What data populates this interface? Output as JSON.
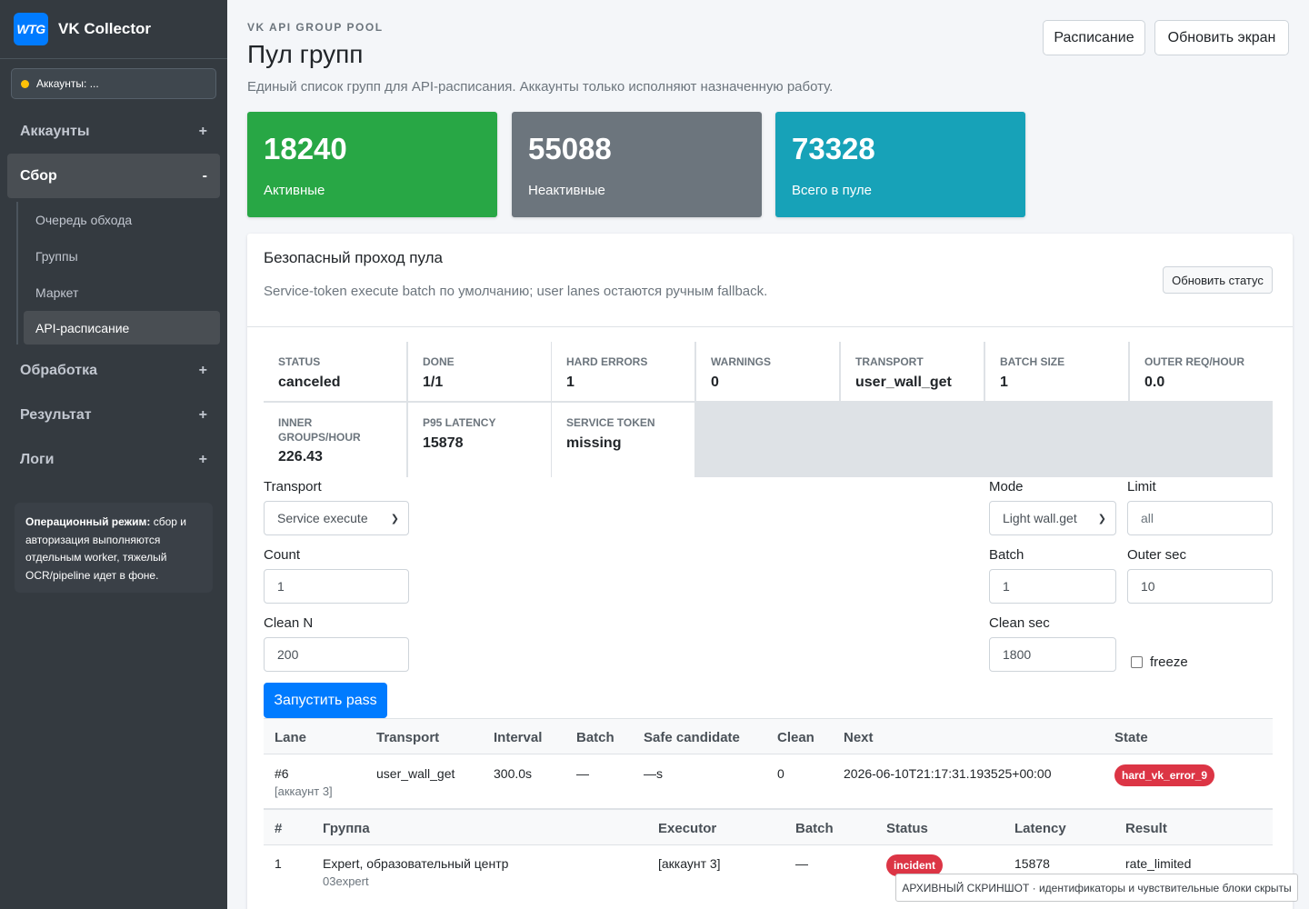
{
  "brand": {
    "logo": "WTG",
    "title": "VK Collector"
  },
  "sidebar": {
    "account": "Аккаунты: ...",
    "items": [
      {
        "label": "Аккаунты",
        "sign": "+"
      },
      {
        "label": "Сбор",
        "sign": "-"
      },
      {
        "label": "Обработка",
        "sign": "+"
      },
      {
        "label": "Результат",
        "sign": "+"
      },
      {
        "label": "Логи",
        "sign": "+"
      }
    ],
    "sub_items": [
      "Очередь обхода",
      "Группы",
      "Маркет",
      "API-расписание"
    ],
    "note_bold": "Операционный режим:",
    "note_text": " сбор и авторизация выполняются отдельным worker, тяжелый OCR/pipeline идет в фоне."
  },
  "header": {
    "kicker": "VK API GROUP POOL",
    "title": "Пул групп",
    "subtitle": "Единый список групп для API-расписания. Аккаунты только исполняют назначенную работу.",
    "btn_schedule": "Расписание",
    "btn_refresh": "Обновить экран"
  },
  "stats": [
    {
      "value": "18240",
      "label": "Активные",
      "color": "#28a745"
    },
    {
      "value": "55088",
      "label": "Неактивные",
      "color": "#6c757d"
    },
    {
      "value": "73328",
      "label": "Всего в пуле",
      "color": "#17a2b8"
    }
  ],
  "pass": {
    "title": "Безопасный проход пула",
    "subtitle": "Service-token execute batch по умолчанию; user lanes остаются ручным fallback.",
    "status_btn": "Обновить статус",
    "metrics": [
      {
        "key": "STATUS",
        "value": "canceled"
      },
      {
        "key": "DONE",
        "value": "1/1"
      },
      {
        "key": "HARD ERRORS",
        "value": "1"
      },
      {
        "key": "WARNINGS",
        "value": "0"
      },
      {
        "key": "TRANSPORT",
        "value": "user_wall_get"
      },
      {
        "key": "BATCH SIZE",
        "value": "1"
      },
      {
        "key": "OUTER REQ/HOUR",
        "value": "0.0"
      },
      {
        "key": "INNER GROUPS/HOUR",
        "value": "226.43"
      },
      {
        "key": "P95 LATENCY",
        "value": "15878"
      },
      {
        "key": "SERVICE TOKEN",
        "value": "missing"
      }
    ]
  },
  "form": {
    "transport_label": "Transport",
    "transport_value": "Service execute",
    "count_label": "Count",
    "count_value": "1",
    "clean_n_label": "Clean N",
    "clean_n_value": "200",
    "mode_label": "Mode",
    "mode_value": "Light wall.get",
    "limit_label": "Limit",
    "limit_placeholder": "all",
    "batch_label": "Batch",
    "batch_value": "1",
    "outer_sec_label": "Outer sec",
    "outer_sec_value": "10",
    "clean_sec_label": "Clean sec",
    "clean_sec_value": "1800",
    "freeze_label": "freeze",
    "run_btn": "Запустить pass"
  },
  "lanes": {
    "headers": [
      "Lane",
      "Transport",
      "Interval",
      "Batch",
      "Safe candidate",
      "Clean",
      "Next",
      "State"
    ],
    "row": {
      "lane": "#6",
      "lane_sub": "[аккаунт 3]",
      "transport": "user_wall_get",
      "interval": "300.0s",
      "batch": "—",
      "safe": "—s",
      "clean": "0",
      "next": "2026-06-10T21:17:31.193525+00:00",
      "state": "hard_vk_error_9"
    }
  },
  "groups": {
    "headers": [
      "#",
      "Группа",
      "Executor",
      "Batch",
      "Status",
      "Latency",
      "Result"
    ],
    "row": {
      "num": "1",
      "name": "Expert, образовательный центр",
      "slug": "03expert",
      "executor": "[аккаунт 3]",
      "batch": "—",
      "status": "incident",
      "latency": "15878",
      "result": "rate_limited"
    }
  },
  "watermark": "АРХИВНЫЙ СКРИНШОТ · идентификаторы и чувствительные блоки скрыты"
}
